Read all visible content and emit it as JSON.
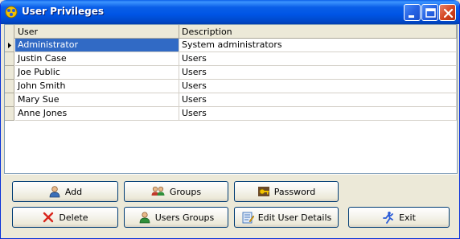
{
  "window": {
    "title": "User Privileges",
    "title_icon": "privileges-app-icon"
  },
  "grid": {
    "columns": [
      "User",
      "Description"
    ],
    "selected_row": 0,
    "rows": [
      {
        "user": "Administrator",
        "description": "System administrators"
      },
      {
        "user": "Justin Case",
        "description": "Users"
      },
      {
        "user": "Joe Public",
        "description": "Users"
      },
      {
        "user": "John Smith",
        "description": "Users"
      },
      {
        "user": "Mary Sue",
        "description": "Users"
      },
      {
        "user": "Anne Jones",
        "description": "Users"
      }
    ]
  },
  "buttons": {
    "add": "Add",
    "groups": "Groups",
    "password": "Password",
    "delete": "Delete",
    "users_groups": "Users Groups",
    "edit_user_details": "Edit User Details",
    "exit": "Exit"
  },
  "colors": {
    "titlebar": "#0055e5",
    "selection": "#316ac5",
    "window_bg": "#ece9d8"
  }
}
